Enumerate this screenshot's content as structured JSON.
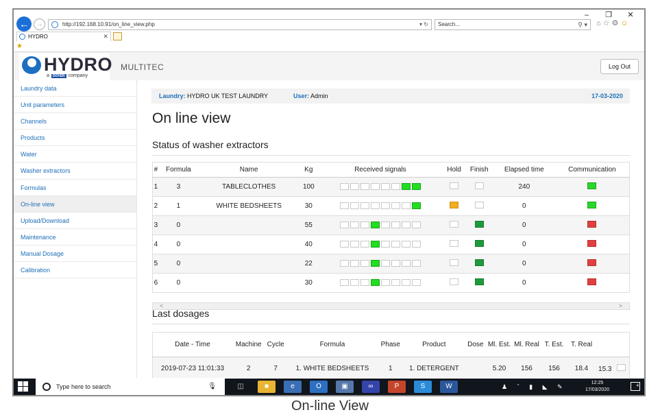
{
  "browser": {
    "url": "http://192.168.10.91/on_line_view.php",
    "search_placeholder": "Search...",
    "tab_title": "HYDRO",
    "window_controls": [
      "–",
      "❐",
      "✕"
    ]
  },
  "header": {
    "logo_text": "HYDRO",
    "logo_sub_pre": "a",
    "logo_sub_brand": "DOVER",
    "logo_sub_post": "company",
    "brand_subtitle": "MULTITEC",
    "logout_label": "Log Out"
  },
  "sidebar": {
    "items": [
      {
        "label": "Laundry data"
      },
      {
        "label": "Unit parameters"
      },
      {
        "label": "Channels"
      },
      {
        "label": "Products"
      },
      {
        "label": "Water"
      },
      {
        "label": "Washer extractors"
      },
      {
        "label": "Formulas"
      },
      {
        "label": "On-line view",
        "active": true
      },
      {
        "label": "Upload/Download"
      },
      {
        "label": "Maintenance"
      },
      {
        "label": "Manual Dosage"
      },
      {
        "label": "Calibration"
      }
    ]
  },
  "info": {
    "laundry_label": "Laundry:",
    "laundry_value": "HYDRO UK TEST LAUNDRY",
    "user_label": "User:",
    "user_value": "Admin",
    "date": "17-03-2020"
  },
  "page_title": "On line view",
  "washers": {
    "title": "Status of washer extractors",
    "columns": [
      "#",
      "Formula",
      "Name",
      "Kg",
      "Received signals",
      "Hold",
      "Finish",
      "Elapsed time",
      "Communication"
    ],
    "rows": [
      {
        "num": "1",
        "formula": "3",
        "name": "TABLECLOTHES",
        "kg": "100",
        "signals": [
          0,
          0,
          0,
          0,
          0,
          0,
          1,
          1
        ],
        "hold": "off",
        "finish": "off",
        "elapsed": "240",
        "comm": "green"
      },
      {
        "num": "2",
        "formula": "1",
        "name": "WHITE BEDSHEETS",
        "kg": "30",
        "signals": [
          0,
          0,
          0,
          0,
          0,
          0,
          0,
          1
        ],
        "hold": "orange",
        "finish": "off",
        "elapsed": "0",
        "comm": "green"
      },
      {
        "num": "3",
        "formula": "0",
        "name": "",
        "kg": "55",
        "signals": [
          0,
          0,
          0,
          1,
          0,
          0,
          0,
          0
        ],
        "hold": "off",
        "finish": "green",
        "elapsed": "0",
        "comm": "red"
      },
      {
        "num": "4",
        "formula": "0",
        "name": "",
        "kg": "40",
        "signals": [
          0,
          0,
          0,
          1,
          0,
          0,
          0,
          0
        ],
        "hold": "off",
        "finish": "green",
        "elapsed": "0",
        "comm": "red"
      },
      {
        "num": "5",
        "formula": "0",
        "name": "",
        "kg": "22",
        "signals": [
          0,
          0,
          0,
          1,
          0,
          0,
          0,
          0
        ],
        "hold": "off",
        "finish": "green",
        "elapsed": "0",
        "comm": "red"
      },
      {
        "num": "6",
        "formula": "0",
        "name": "",
        "kg": "30",
        "signals": [
          0,
          0,
          0,
          1,
          0,
          0,
          0,
          0
        ],
        "hold": "off",
        "finish": "green",
        "elapsed": "0",
        "comm": "red"
      }
    ]
  },
  "last_dosages": {
    "title": "Last dosages",
    "columns": [
      "Date - Time",
      "Machine",
      "Cycle",
      "Formula",
      "Phase",
      "Product",
      "Dose",
      "Ml. Est.",
      "Ml. Real",
      "T. Est.",
      "T. Real"
    ],
    "rows": [
      {
        "date_time": "2019-07-23 11:01:33",
        "machine": "2",
        "cycle": "7",
        "formula": "1. WHITE BEDSHEETS",
        "phase": "1",
        "product": "1. DETERGENT",
        "dose": "",
        "ml_est": "5.20",
        "ml_real": "156",
        "t_est": "156",
        "t_real": "18.4",
        "extra": "15.3"
      }
    ]
  },
  "taskbar": {
    "search_placeholder": "Type here to search",
    "time": "12:25",
    "date": "17/03/2020",
    "notification_count": "4"
  },
  "caption": "On-line View"
}
